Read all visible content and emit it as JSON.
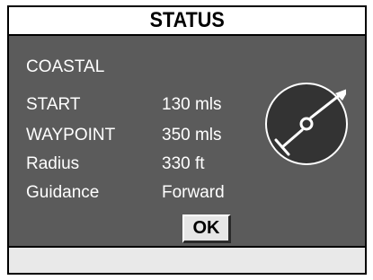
{
  "window": {
    "title": "STATUS"
  },
  "route_name": "COASTAL",
  "fields": [
    {
      "label": "START",
      "value": "130 mls"
    },
    {
      "label": "WAYPOINT",
      "value": "350 mls"
    },
    {
      "label": "Radius",
      "value": "330 ft"
    },
    {
      "label": "Guidance",
      "value": "Forward"
    }
  ],
  "ok_button": {
    "label": "OK"
  },
  "compass": {
    "icon": "heading-indicator-icon"
  },
  "colors": {
    "panel_bg": "#5b5b5b",
    "title_bg": "#ffffff",
    "footer_bg": "#e9e9e9",
    "text": "#ffffff",
    "button_bg": "#e6e6e6"
  }
}
